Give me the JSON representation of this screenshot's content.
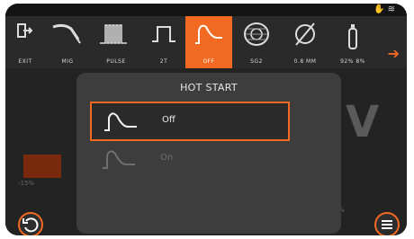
{
  "status": {
    "icons": [
      "hand-icon",
      "wifi-icon"
    ]
  },
  "toolbar": {
    "items": [
      {
        "label": "EXIT",
        "icon": "exit-icon"
      },
      {
        "label": "MIG",
        "icon": "mig-torch-icon"
      },
      {
        "label": "PULSE",
        "icon": "pulse-icon"
      },
      {
        "label": "2T",
        "icon": "2t-trigger-icon"
      },
      {
        "label": "OFF",
        "icon": "hot-start-icon",
        "active": true
      },
      {
        "label": "SG2",
        "icon": "wire-spool-icon"
      },
      {
        "label": "0.8 MM",
        "icon": "diameter-icon"
      },
      {
        "label": "92% 8%",
        "icon": "gas-cylinder-icon"
      }
    ],
    "more": "next-arrow-icon"
  },
  "background": {
    "value_unit": "V",
    "left_percent": "-15%",
    "right_percent": "%"
  },
  "modal": {
    "title": "HOT START",
    "options": [
      {
        "label": "Off",
        "selected": true
      },
      {
        "label": "On",
        "selected": false,
        "disabled": true
      }
    ]
  },
  "buttons": {
    "back": "back-icon",
    "menu": "menu-icon"
  },
  "colors": {
    "accent": "#f26a21",
    "background": "#1f1f1f",
    "modal": "#3d3d3d"
  }
}
